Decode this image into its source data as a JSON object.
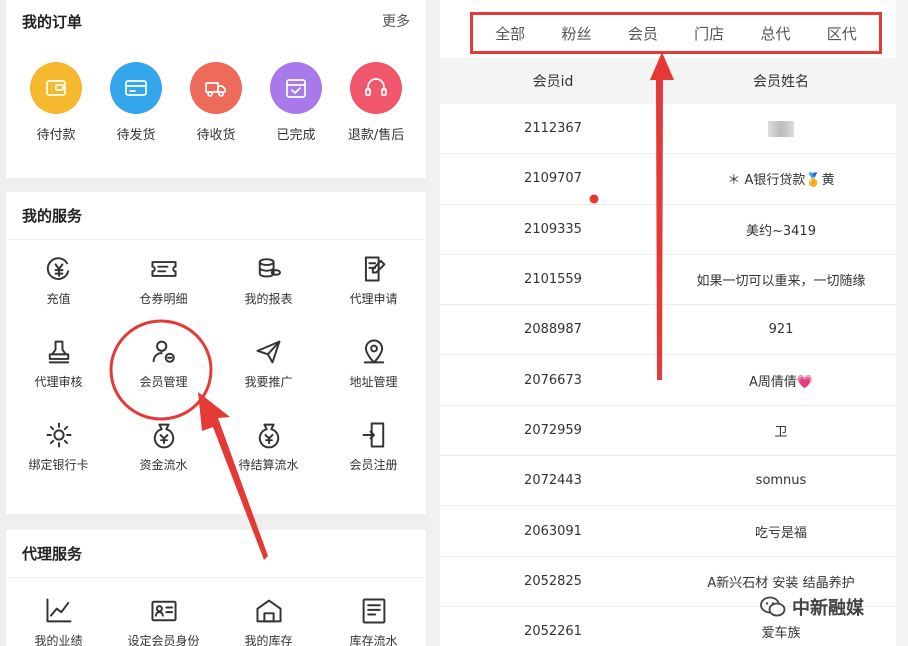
{
  "orders": {
    "title": "我的订单",
    "more": "更多",
    "items": [
      {
        "label": "待付款",
        "icon": "wallet-icon",
        "color": "#f5b82e"
      },
      {
        "label": "待发货",
        "icon": "card-icon",
        "color": "#36a6ec"
      },
      {
        "label": "待收货",
        "icon": "delivery-truck-icon",
        "color": "#ee6a5a"
      },
      {
        "label": "已完成",
        "icon": "calendar-check-icon",
        "color": "#a879ea"
      },
      {
        "label": "退款/售后",
        "icon": "headset-icon",
        "color": "#f2566d"
      }
    ]
  },
  "services": {
    "title": "我的服务",
    "items": [
      {
        "label": "充值",
        "icon": "yen-coin-icon"
      },
      {
        "label": "仓券明细",
        "icon": "ticket-icon"
      },
      {
        "label": "我的报表",
        "icon": "coin-stack-icon"
      },
      {
        "label": "代理申请",
        "icon": "document-edit-icon"
      },
      {
        "label": "代理审核",
        "icon": "stamp-icon"
      },
      {
        "label": "会员管理",
        "icon": "member-manage-icon"
      },
      {
        "label": "我要推广",
        "icon": "paper-plane-icon"
      },
      {
        "label": "地址管理",
        "icon": "location-pin-icon"
      },
      {
        "label": "绑定银行卡",
        "icon": "gear-bank-icon"
      },
      {
        "label": "资金流水",
        "icon": "money-bag-icon"
      },
      {
        "label": "待结算流水",
        "icon": "money-bag-pending-icon"
      },
      {
        "label": "会员注册",
        "icon": "register-door-icon"
      }
    ]
  },
  "agent_services": {
    "title": "代理服务",
    "items": [
      {
        "label": "我的业绩",
        "icon": "line-chart-icon"
      },
      {
        "label": "设定会员身份",
        "icon": "id-card-icon"
      },
      {
        "label": "我的库存",
        "icon": "warehouse-icon"
      },
      {
        "label": "库存流水",
        "icon": "inventory-list-icon"
      }
    ]
  },
  "member_list": {
    "tabs": [
      "全部",
      "粉丝",
      "会员",
      "门店",
      "总代",
      "区代"
    ],
    "headers": {
      "id": "会员id",
      "name": "会员姓名"
    },
    "rows": [
      {
        "id": "2112367",
        "name": ""
      },
      {
        "id": "2109707",
        "name": "＊ A银行贷款🏅黄"
      },
      {
        "id": "2109335",
        "name": "美约~3419"
      },
      {
        "id": "2101559",
        "name": "如果一切可以重来，一切随缘"
      },
      {
        "id": "2088987",
        "name": "921"
      },
      {
        "id": "2076673",
        "name": "A周倩倩💗"
      },
      {
        "id": "2072959",
        "name": "卫"
      },
      {
        "id": "2072443",
        "name": "somnus"
      },
      {
        "id": "2063091",
        "name": "吃亏是福"
      },
      {
        "id": "2052825",
        "name": "A新兴石材 安装 结晶养护"
      },
      {
        "id": "2052261",
        "name": "爱车族"
      }
    ]
  },
  "watermark": "中新融媒",
  "accent_red": "#e53935"
}
